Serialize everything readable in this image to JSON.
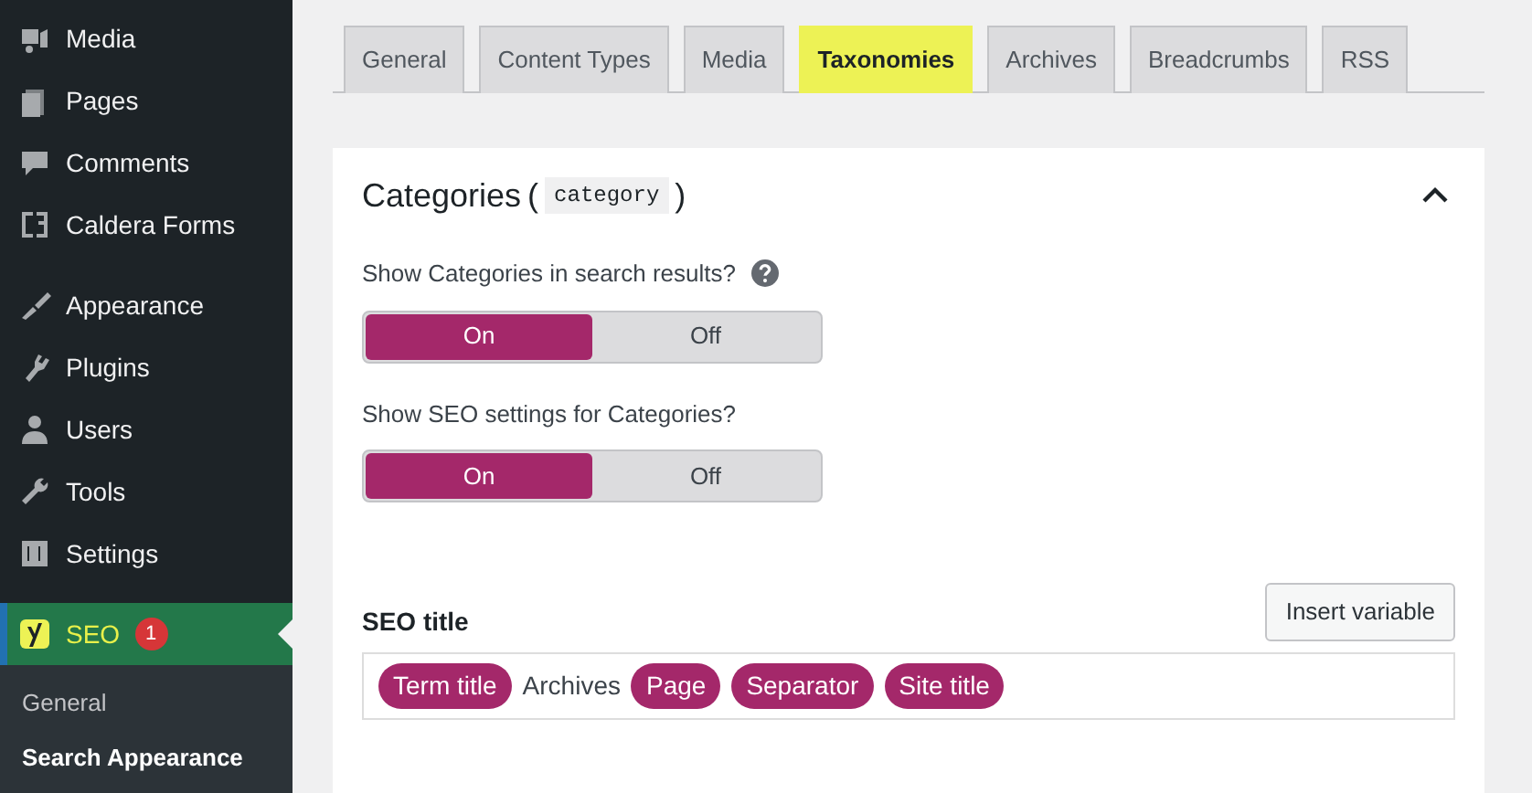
{
  "sidebar": {
    "items": [
      {
        "label": "Media",
        "selected": false
      },
      {
        "label": "Pages",
        "selected": false
      },
      {
        "label": "Comments",
        "selected": false
      },
      {
        "label": "Caldera Forms",
        "selected": false
      },
      {
        "label": "Appearance",
        "selected": false
      },
      {
        "label": "Plugins",
        "selected": false
      },
      {
        "label": "Users",
        "selected": false
      },
      {
        "label": "Tools",
        "selected": false
      },
      {
        "label": "Settings",
        "selected": false
      },
      {
        "label": "SEO",
        "selected": true,
        "badge": "1"
      }
    ],
    "submenu": [
      {
        "label": "General",
        "selected": false
      },
      {
        "label": "Search Appearance",
        "selected": true
      }
    ]
  },
  "tabs": [
    {
      "label": "General",
      "selected": false
    },
    {
      "label": "Content Types",
      "selected": false
    },
    {
      "label": "Media",
      "selected": false
    },
    {
      "label": "Taxonomies",
      "selected": true
    },
    {
      "label": "Archives",
      "selected": false
    },
    {
      "label": "Breadcrumbs",
      "selected": false
    },
    {
      "label": "RSS",
      "selected": false
    }
  ],
  "panel": {
    "title": "Categories",
    "paren_open": "(",
    "code": "category",
    "paren_close": ")",
    "expanded": true,
    "toggles": [
      {
        "question": "Show Categories in search results?",
        "help": true,
        "options": [
          {
            "label": "On",
            "selected": true
          },
          {
            "label": "Off",
            "selected": false
          }
        ]
      },
      {
        "question": "Show SEO settings for Categories?",
        "options": [
          {
            "label": "On",
            "selected": true
          },
          {
            "label": "Off",
            "selected": false
          }
        ]
      }
    ],
    "seo_title": {
      "label": "SEO title",
      "button": "Insert variable",
      "tokens": [
        {
          "kind": "variable",
          "text": "Term title"
        },
        {
          "kind": "text",
          "text": "Archives"
        },
        {
          "kind": "variable",
          "text": "Page"
        },
        {
          "kind": "variable",
          "text": "Separator"
        },
        {
          "kind": "variable",
          "text": "Site title"
        }
      ]
    }
  }
}
